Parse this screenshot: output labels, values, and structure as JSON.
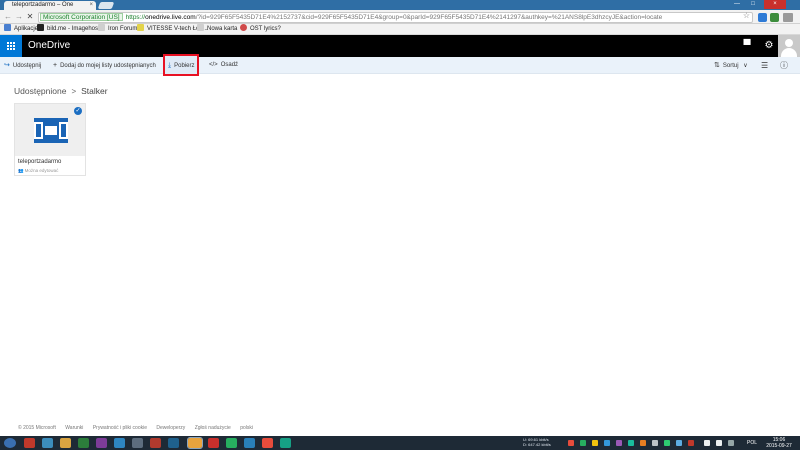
{
  "browser": {
    "tab_title": "teleportzadarmo – One",
    "tab_close": "×",
    "window_controls": [
      "—",
      "□",
      "×"
    ],
    "back": "←",
    "forward": "→",
    "reload": "✕",
    "ev_label": "Microsoft Corporation [US]",
    "url_protocol": "https://",
    "url_host": "onedrive.live.com",
    "url_rest": "/?id=929F65F5435D71E4%2152737&cid=929F65F5435D71E4&group=0&parId=929F65F5435D71E4%2141297&authkey=%21ANS8lpE3dhzcyJE&action=locate",
    "star": "☆",
    "bookmarks": [
      "Aplikacje",
      "bild.me - Imagehost...",
      "Iron Forum",
      "VITESSE V-tech Łód...",
      "Nowa karta",
      "OST lyrics?"
    ]
  },
  "app": {
    "brand": "OneDrive",
    "chat_icon": "▀",
    "settings_icon": "⚙"
  },
  "commands": {
    "share": "Udostępnij",
    "add": "Dodaj do mojej listy udostępnianych",
    "download": "Pobierz",
    "embed": "Osadź",
    "sort": "Sortuj",
    "icon_share": "↪",
    "icon_add": "+",
    "icon_download": "⤓",
    "icon_embed": "</>",
    "icon_sort": "⇅",
    "icon_chevron": "∨",
    "icon_list": "☰",
    "icon_info": "ⓘ"
  },
  "breadcrumb": {
    "root": "Udostępnione",
    "separator": ">",
    "current": "Stalker"
  },
  "tile": {
    "name": "teleportzadarmo",
    "meta": "Można edytować",
    "check": "✓",
    "people_icon": "👥"
  },
  "footer": {
    "links": [
      "© 2015 Microsoft",
      "Warunki",
      "Prywatność i pliki cookie",
      "Deweloperzy",
      "Zgłoś nadużycie",
      "polski"
    ]
  },
  "taskbar": {
    "net_up_label": "U:",
    "net_up": "69.61 kbit/s",
    "net_down_label": "D:",
    "net_down": "647.42 kbit/s",
    "lang": "POL",
    "time": "15:06",
    "date": "2015-09-27"
  },
  "colors": {
    "accent": "#0078d7",
    "highlight_border": "#e81123",
    "command_bar": "#eaf2fa"
  }
}
